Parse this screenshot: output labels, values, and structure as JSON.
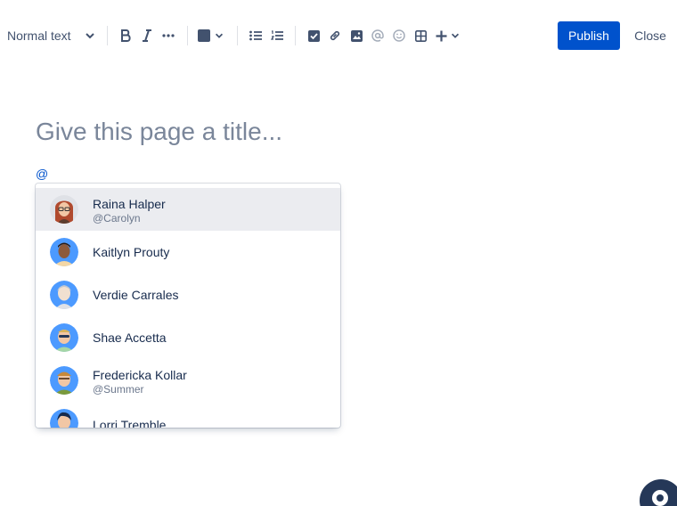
{
  "toolbar": {
    "text_style": "Normal text",
    "icons": [
      "bold-icon",
      "italic-icon",
      "more-formatting-icon",
      "text-color-icon",
      "bullet-list-icon",
      "numbered-list-icon",
      "action-item-icon",
      "link-icon",
      "image-icon",
      "mention-icon",
      "emoji-icon",
      "table-icon",
      "insert-icon"
    ],
    "publish_label": "Publish",
    "close_label": "Close"
  },
  "title": {
    "placeholder": "Give this page a title..."
  },
  "editor": {
    "mention_trigger": "@"
  },
  "mentions": [
    {
      "name": "Raina Halper",
      "handle": "@Carolyn",
      "selected": true
    },
    {
      "name": "Kaitlyn Prouty",
      "handle": ""
    },
    {
      "name": "Verdie Carrales",
      "handle": ""
    },
    {
      "name": "Shae Accetta",
      "handle": ""
    },
    {
      "name": "Fredericka Kollar",
      "handle": "@Summer"
    },
    {
      "name": "Lorri Tremble",
      "handle": ""
    }
  ],
  "colors": {
    "primary": "#0052cc",
    "text": "#172b4d",
    "subtle": "#6b778c",
    "selected_bg": "#ebecf0"
  }
}
